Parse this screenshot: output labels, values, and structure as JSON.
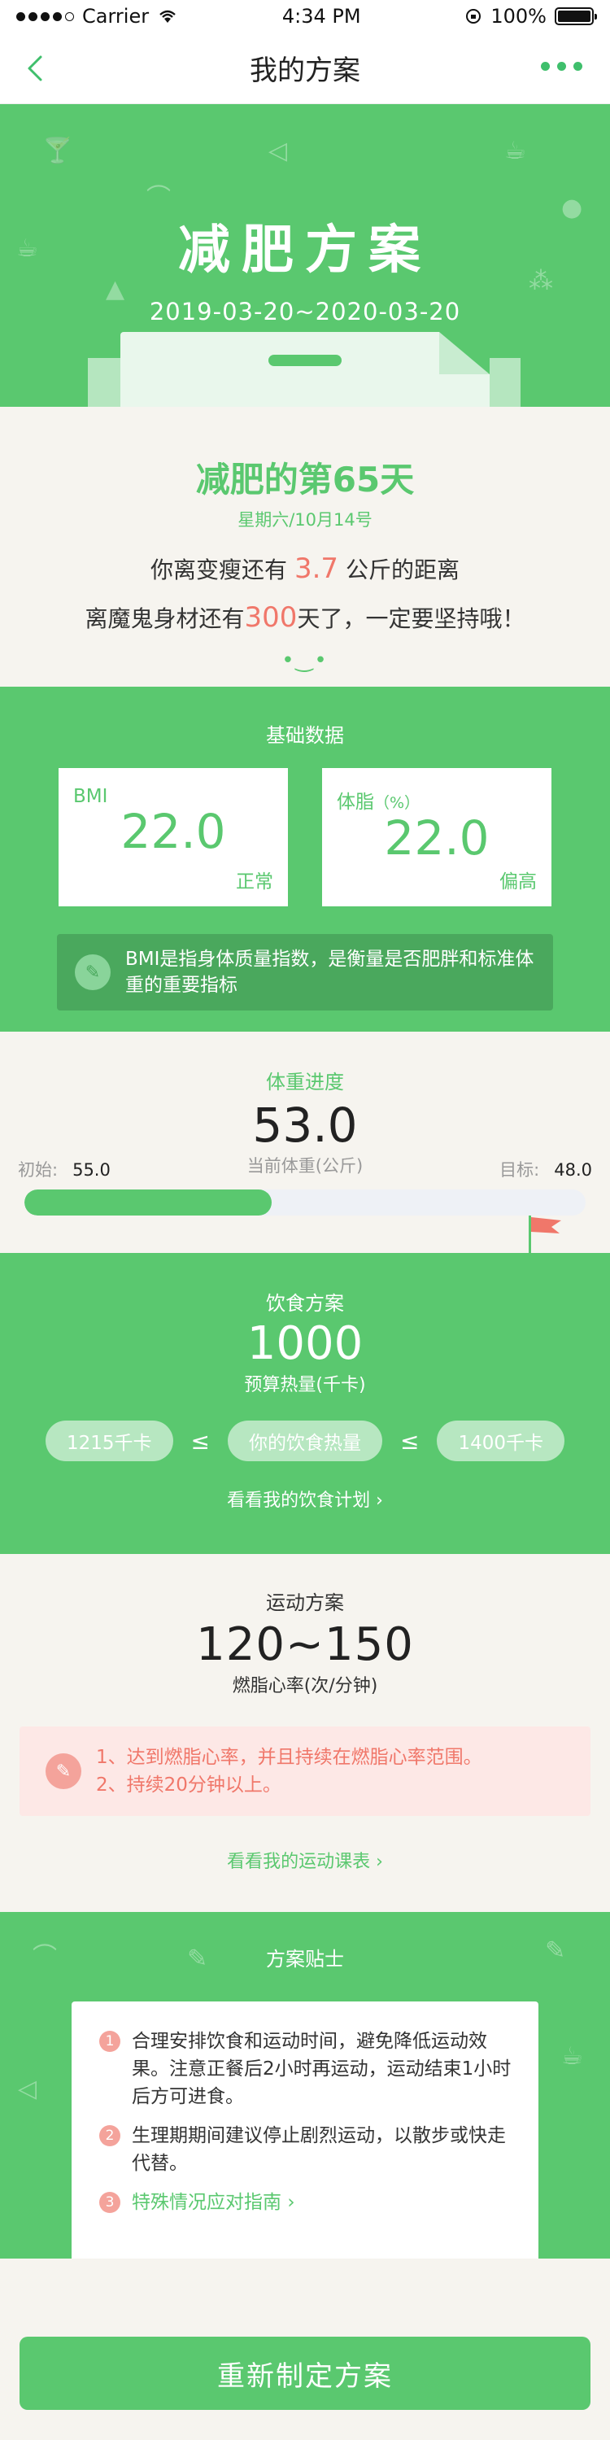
{
  "status_bar": {
    "carrier": "Carrier",
    "time": "4:34 PM",
    "battery": "100%"
  },
  "nav": {
    "title": "我的方案"
  },
  "hero": {
    "title": "减肥方案",
    "dates": "2019-03-20~2020-03-20"
  },
  "progress": {
    "day_title": "减肥的第65天",
    "date": "星期六/10月14号",
    "line1_prefix": "你离变瘦还有",
    "line1_value": "3.7",
    "line1_suffix": "公斤的距离",
    "line2_prefix": "离魔鬼身材还有",
    "line2_value": "300",
    "line2_suffix": "天了，一定要坚持哦！"
  },
  "basic": {
    "title": "基础数据",
    "bmi": {
      "label": "BMI",
      "value": "22.0",
      "status": "正常"
    },
    "fat": {
      "label": "体脂",
      "unit": "（%）",
      "value": "22.0",
      "status": "偏高"
    },
    "note": "BMI是指身体质量指数，是衡量是否肥胖和标准体重的重要指标"
  },
  "weight": {
    "title": "体重进度",
    "current": "53.0",
    "current_label": "当前体重(公斤)",
    "start_label": "初始:",
    "start_value": "55.0",
    "target_label": "目标:",
    "target_value": "48.0",
    "progress_fraction": 0.44
  },
  "diet": {
    "title": "饮食方案",
    "value": "1000",
    "sub": "预算热量(千卡)",
    "min": "1215千卡",
    "mid": "你的饮食热量",
    "max": "1400千卡",
    "le": "≤",
    "link": "看看我的饮食计划"
  },
  "exercise": {
    "title": "运动方案",
    "value": "120~150",
    "sub": "燃脂心率(次/分钟)",
    "note_line1": "1、达到燃脂心率，并且持续在燃脂心率范围。",
    "note_line2": "2、持续20分钟以上。",
    "link": "看看我的运动课表"
  },
  "tips": {
    "title": "方案贴士",
    "items": [
      {
        "n": "1",
        "text": "合理安排饮食和运动时间，避免降低运动效果。注意正餐后2小时再运动，运动结束1小时后方可进食。"
      },
      {
        "n": "2",
        "text": "生理期期间建议停止剧烈运动，以散步或快走代替。"
      },
      {
        "n": "3",
        "text": "特殊情况应对指南"
      }
    ]
  },
  "cta": {
    "label": "重新制定方案"
  },
  "colors": {
    "primary": "#5ac86f",
    "accent": "#f0776a",
    "background": "#f6f4ef"
  }
}
